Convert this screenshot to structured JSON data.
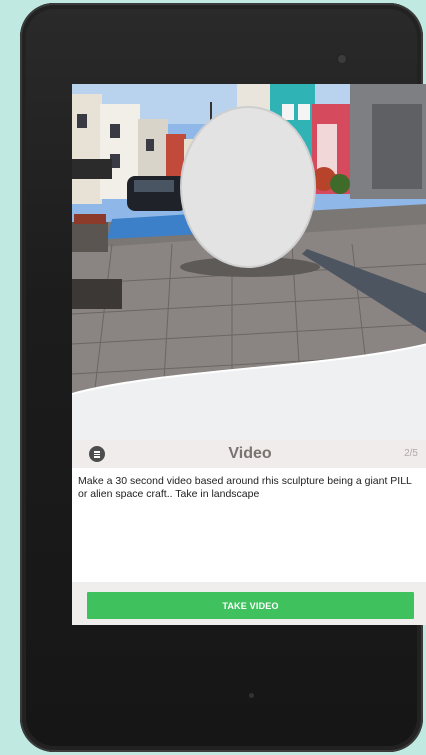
{
  "task": {
    "title": "Video",
    "progress": "2/5",
    "description": "Make a 30 second video based around rhis sculpture being a giant PILL or alien space craft.. Take in landscape",
    "button_label": "TAKE VIDEO"
  },
  "icons": {
    "menu": "menu-icon",
    "camera": "front-camera"
  },
  "colors": {
    "background": "#bfe9e1",
    "button": "#3fc15e",
    "header": "#efeceb"
  }
}
